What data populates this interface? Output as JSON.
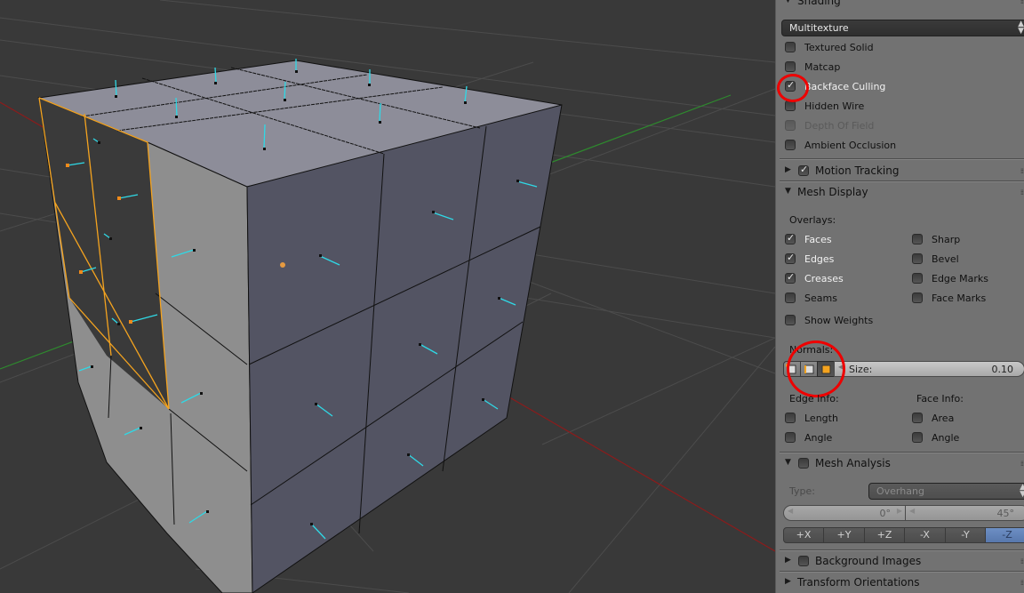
{
  "viewport": {
    "background": "#393939",
    "object": "cube mesh (3x3 subdivided faces) with face normals shown",
    "colors": {
      "grid": "#4a4a4a",
      "x_axis": "#8a1c1c",
      "y_axis": "#2e8a2e",
      "top_face": "#8d8d99",
      "front_face": "#535463",
      "side_face": "#8e8e8e",
      "selected_edge": "#f4a31f",
      "normal": "#2fd9e6",
      "origin": "#e69a40"
    }
  },
  "panel": {
    "shading": {
      "header": "Shading",
      "mode": "Multitexture",
      "options": [
        {
          "label": "Textured Solid",
          "checked": false,
          "disabled": false
        },
        {
          "label": "Matcap",
          "checked": false,
          "disabled": false
        },
        {
          "label": "Backface Culling",
          "checked": true,
          "disabled": false,
          "annotated": true
        },
        {
          "label": "Hidden Wire",
          "checked": false,
          "disabled": false
        },
        {
          "label": "Depth Of Field",
          "checked": false,
          "disabled": true
        },
        {
          "label": "Ambient Occlusion",
          "checked": false,
          "disabled": false
        }
      ]
    },
    "motion_tracking": {
      "header": "Motion Tracking",
      "checked": true,
      "expanded": false
    },
    "mesh_display": {
      "header": "Mesh Display",
      "overlays_label": "Overlays:",
      "overlays_left": [
        {
          "label": "Faces",
          "checked": true
        },
        {
          "label": "Edges",
          "checked": true
        },
        {
          "label": "Creases",
          "checked": true
        },
        {
          "label": "Seams",
          "checked": false
        }
      ],
      "overlays_right": [
        {
          "label": "Sharp",
          "checked": false
        },
        {
          "label": "Bevel",
          "checked": false
        },
        {
          "label": "Edge Marks",
          "checked": false
        },
        {
          "label": "Face Marks",
          "checked": false
        }
      ],
      "show_weights": {
        "label": "Show Weights",
        "checked": false
      },
      "normals_label": "Normals:",
      "normal_buttons": [
        {
          "name": "vertex-normals",
          "active": false
        },
        {
          "name": "split-normals",
          "active": false
        },
        {
          "name": "face-normals",
          "active": true
        }
      ],
      "size_label": "Size:",
      "size_value": "0.10",
      "edge_info_label": "Edge Info:",
      "edge_info": [
        {
          "label": "Length",
          "checked": false
        },
        {
          "label": "Angle",
          "checked": false
        }
      ],
      "face_info_label": "Face Info:",
      "face_info": [
        {
          "label": "Area",
          "checked": false
        },
        {
          "label": "Angle",
          "checked": false
        }
      ]
    },
    "mesh_analysis": {
      "header": "Mesh Analysis",
      "checked": false,
      "type_label": "Type:",
      "type_value": "Overhang",
      "min_value": "0°",
      "max_value": "45°",
      "axes": [
        {
          "label": "+X",
          "selected": false
        },
        {
          "label": "+Y",
          "selected": false
        },
        {
          "label": "+Z",
          "selected": false
        },
        {
          "label": "-X",
          "selected": false
        },
        {
          "label": "-Y",
          "selected": false
        },
        {
          "label": "-Z",
          "selected": true
        }
      ]
    },
    "background_images": {
      "header": "Background Images",
      "checked": false,
      "expanded": false
    },
    "transform_orientations": {
      "header": "Transform Orientations",
      "expanded": false
    }
  }
}
